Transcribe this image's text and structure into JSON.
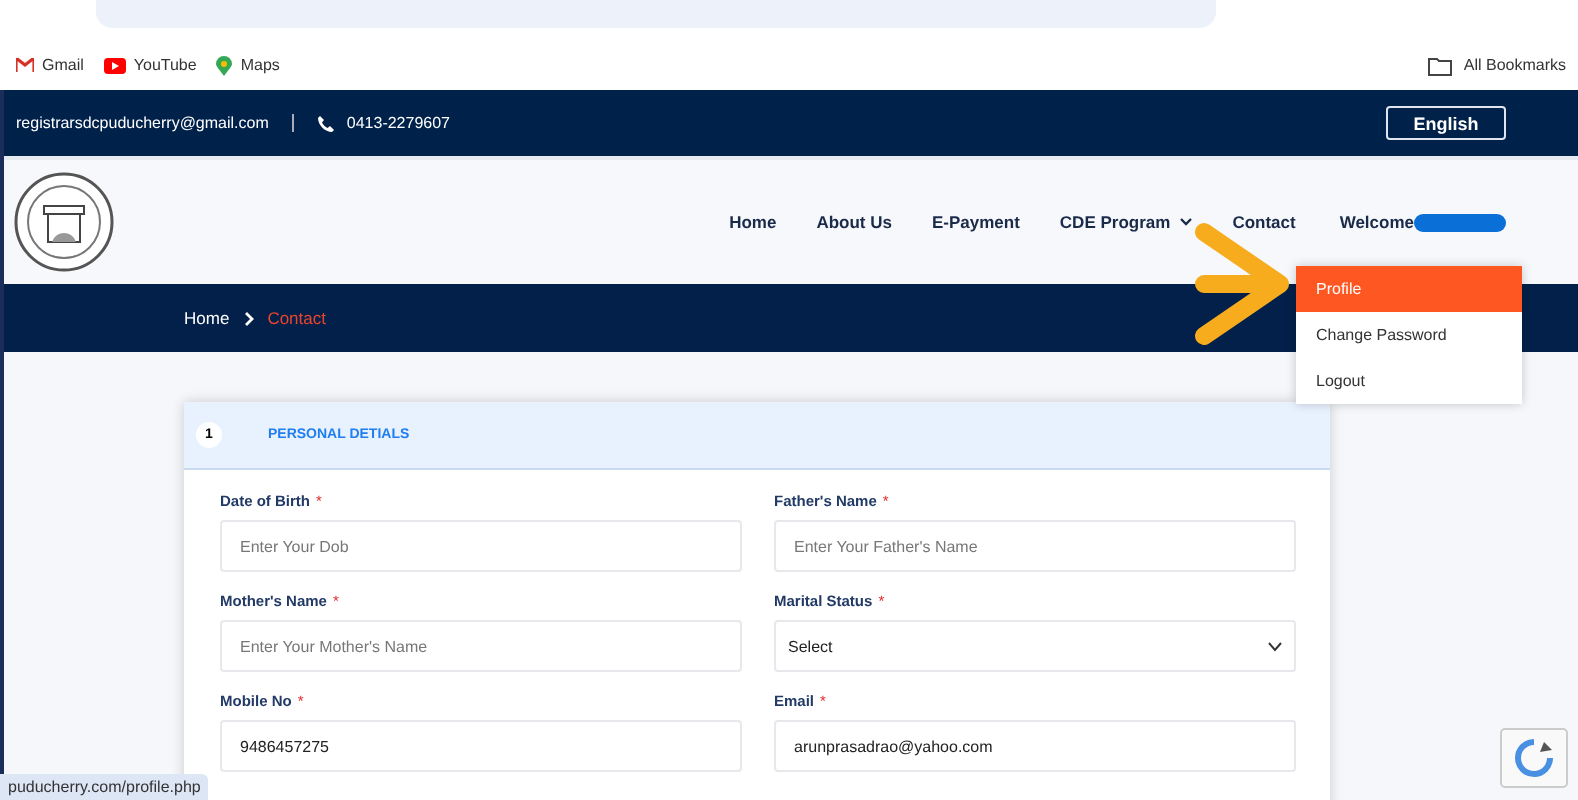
{
  "bookmarks": [
    {
      "label": "Gmail",
      "kind": "gmail"
    },
    {
      "label": "YouTube",
      "kind": "youtube"
    },
    {
      "label": "Maps",
      "kind": "maps"
    }
  ],
  "all_bookmarks": "All Bookmarks",
  "topbar": {
    "email": "registrarsdcpuducherry@gmail.com",
    "phone": "0413-2279607",
    "language": "English"
  },
  "nav": [
    {
      "label": "Home",
      "has_caret": false
    },
    {
      "label": "About Us",
      "has_caret": false
    },
    {
      "label": "E-Payment",
      "has_caret": false
    },
    {
      "label": "CDE Program",
      "has_caret": true
    },
    {
      "label": "Contact",
      "has_caret": false
    }
  ],
  "welcome": "Welcome",
  "breadcrumb": [
    {
      "label": "Home",
      "current": false
    },
    {
      "label": "Contact",
      "current": true
    }
  ],
  "user_menu": [
    {
      "label": "Profile",
      "selected": true
    },
    {
      "label": "Change Password",
      "selected": false
    },
    {
      "label": "Logout",
      "selected": false
    }
  ],
  "section": {
    "number": "1",
    "title": "PERSONAL DETIALS"
  },
  "fields": [
    {
      "label": "Date of Birth",
      "required_mark": "*",
      "kind": "input",
      "placeholder": "Enter Your Dob"
    },
    {
      "label": "Father's Name",
      "required_mark": "*",
      "kind": "input",
      "placeholder": "Enter Your Father's Name"
    },
    {
      "label": "Mother's Name",
      "required_mark": "*",
      "kind": "input",
      "placeholder": "Enter Your Mother's Name"
    },
    {
      "label": "Marital Status",
      "required_mark": "*",
      "kind": "select",
      "value": "Select"
    },
    {
      "label": "Mobile No",
      "required_mark": "*",
      "kind": "input",
      "value": "9486457275"
    },
    {
      "label": "Email",
      "required_mark": "*",
      "kind": "input",
      "value": "arunprasadrao@yahoo.com"
    }
  ],
  "status_url": "puducherry.com/profile.php"
}
